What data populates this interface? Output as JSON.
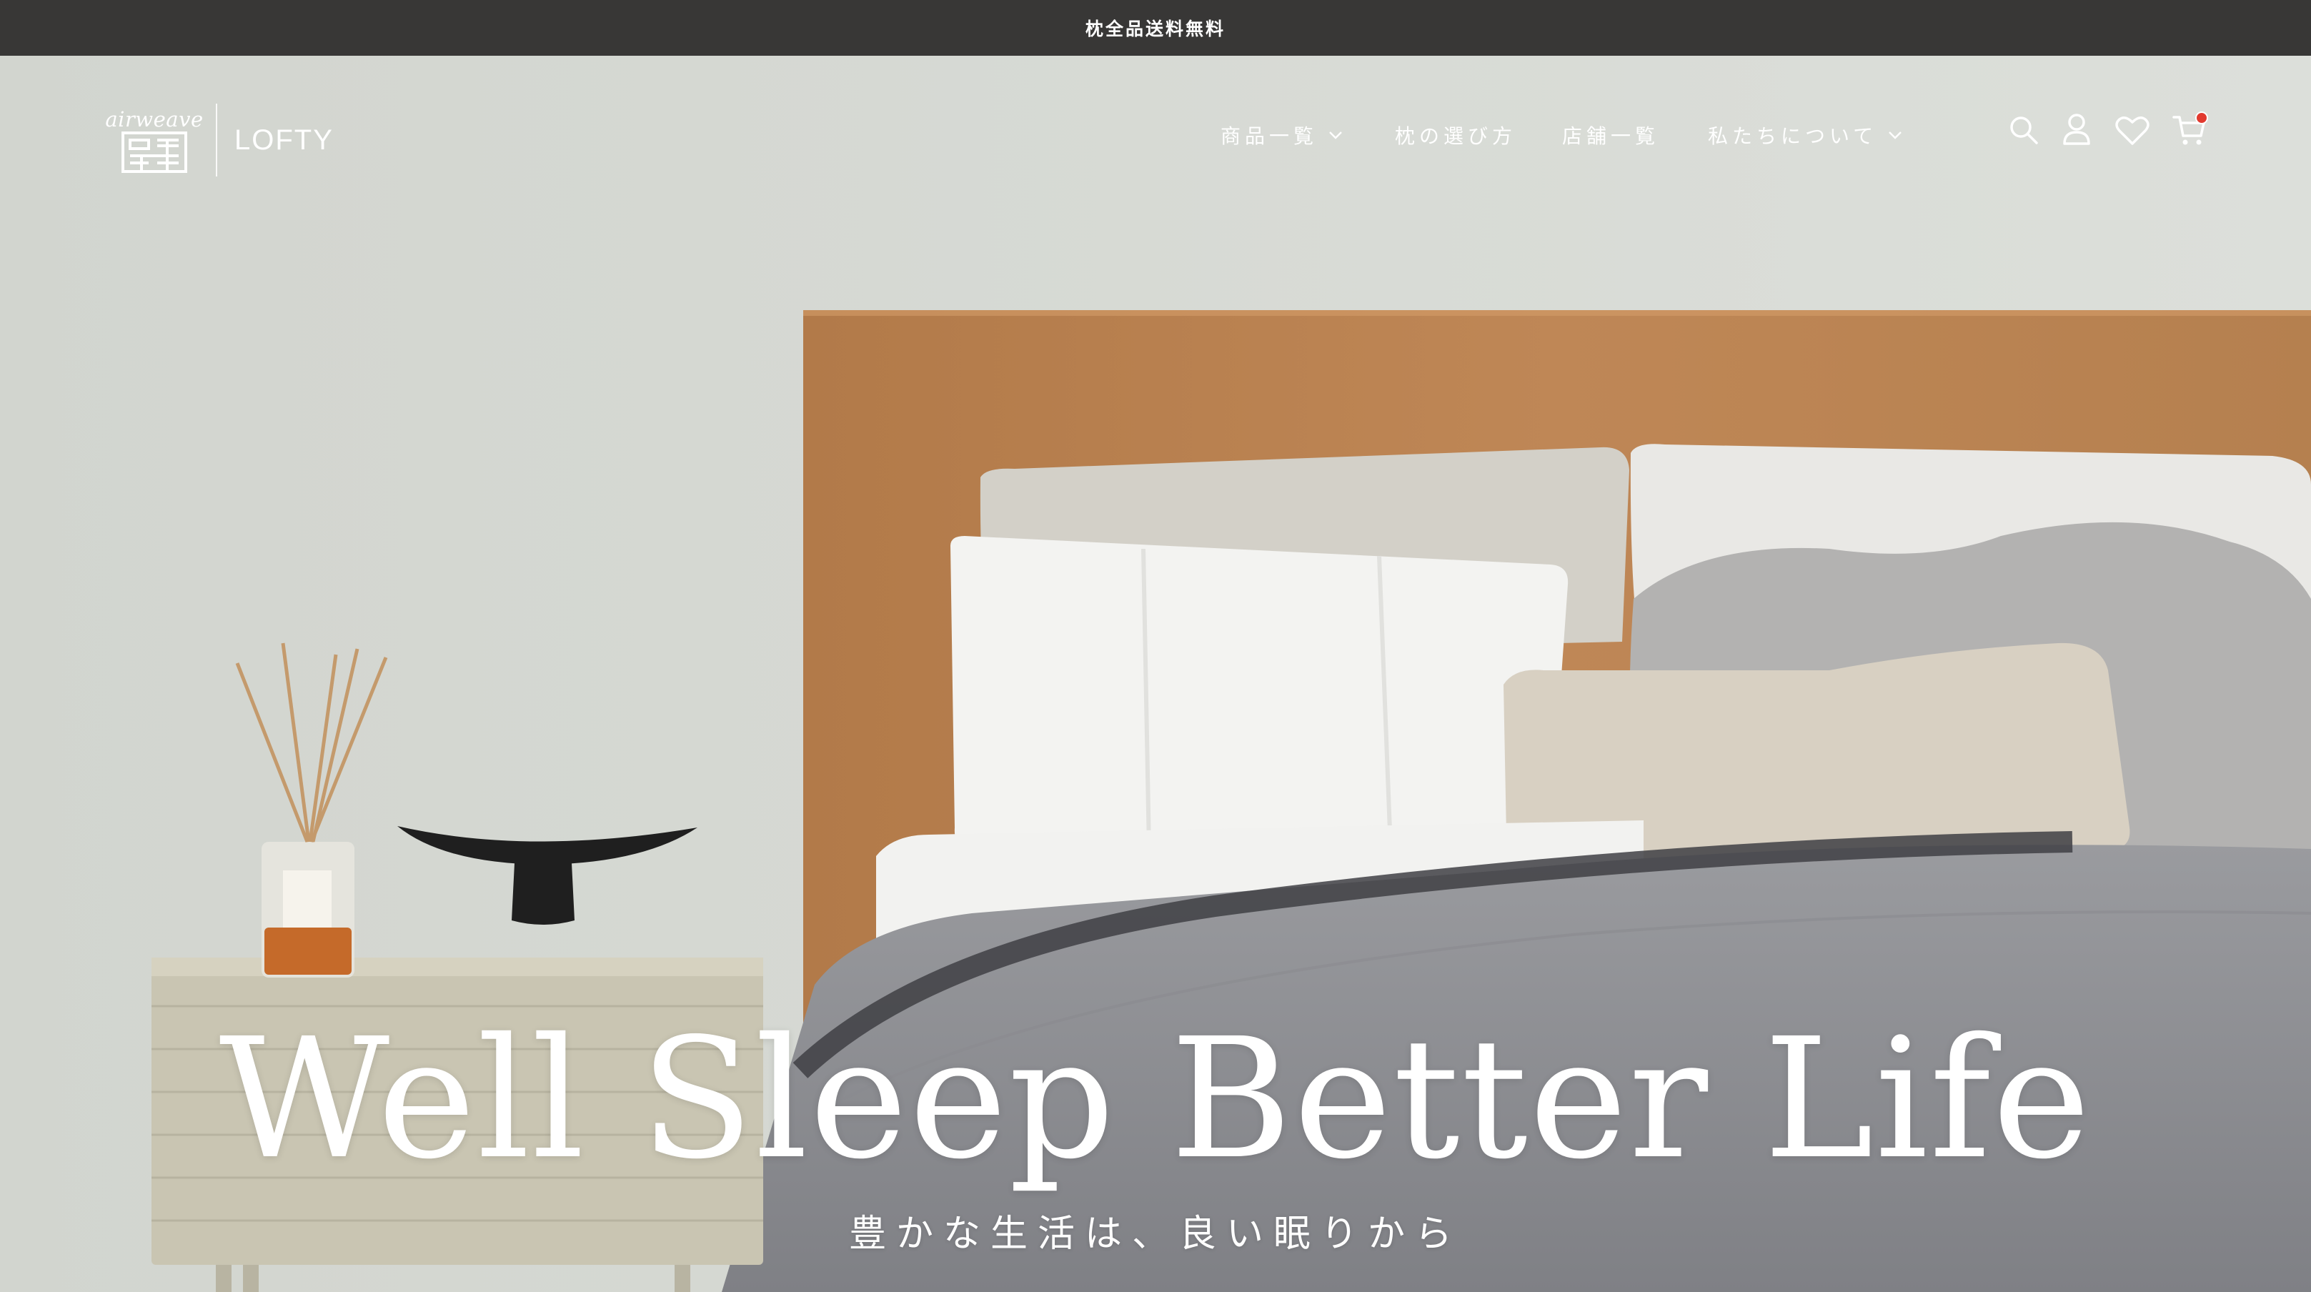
{
  "announcement": {
    "text": "枕全品送料無料"
  },
  "brand": {
    "script": "airweave",
    "name": "LOFTY",
    "divider": "|"
  },
  "nav": {
    "items": [
      {
        "label": "商品一覧",
        "has_dropdown": true
      },
      {
        "label": "枕の選び方",
        "has_dropdown": false
      },
      {
        "label": "店舗一覧",
        "has_dropdown": false
      },
      {
        "label": "私たちについて",
        "has_dropdown": true
      }
    ]
  },
  "header_icons": [
    "search-icon",
    "account-icon",
    "wishlist-heart-icon",
    "cart-icon"
  ],
  "hero": {
    "headline": "Well Sleep Better Life",
    "subheadline": "豊かな生活は、良い眠りから"
  },
  "colors": {
    "announcement_bg": "#383736",
    "text_on_dark": "#ffffff",
    "cart_badge": "#e23a2f",
    "headboard": "#b9804f",
    "blanket": "#8e8f93"
  }
}
